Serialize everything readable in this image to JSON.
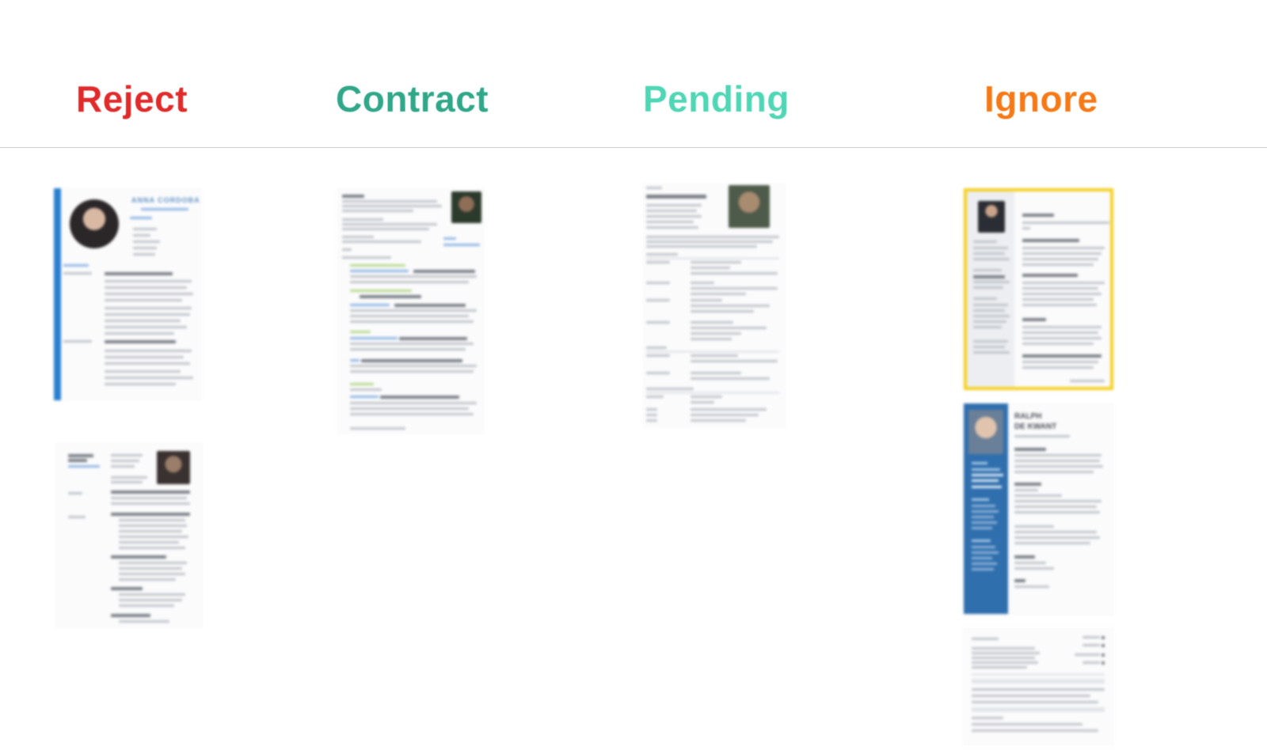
{
  "columns": [
    {
      "title": "Reject",
      "color": "#e02b2b"
    },
    {
      "title": "Contract",
      "color": "#2fa788"
    },
    {
      "title": "Pending",
      "color": "#4fd6b4"
    },
    {
      "title": "Ignore",
      "color": "#f57a17"
    }
  ],
  "cards": {
    "reject_1": {
      "name": "ANNA CORDOBA"
    },
    "ignore_2": {
      "name_line1": "RALPH",
      "name_line2": "DE KWANT"
    }
  },
  "colors": {
    "divider": "#cfcfd4",
    "selected_border": "#f5d01f",
    "sidebar_blue": "#2f6fad",
    "accent_bar": "#2a7fd0"
  }
}
